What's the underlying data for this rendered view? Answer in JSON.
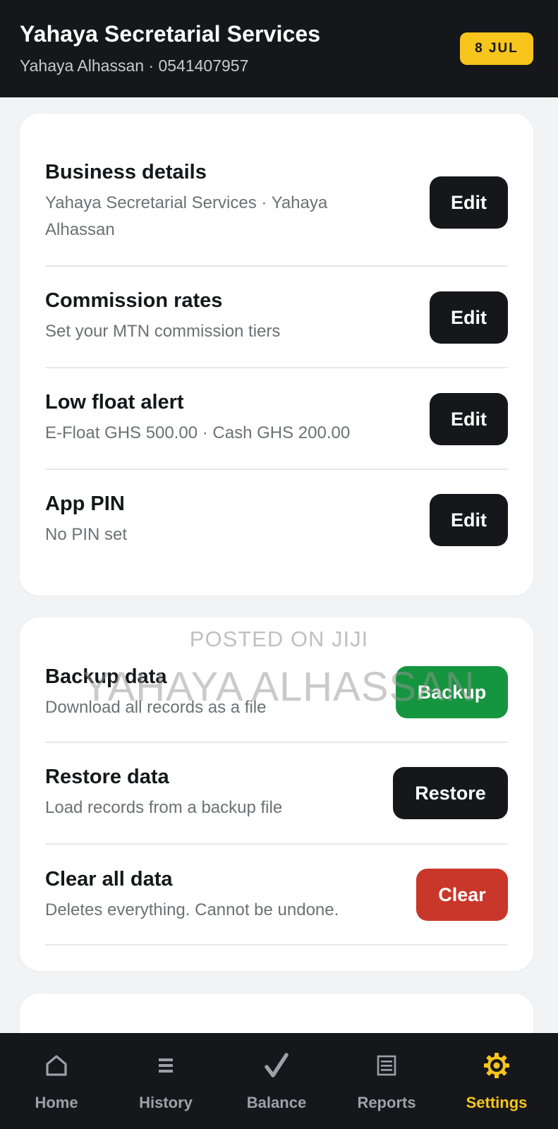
{
  "header": {
    "title": "Yahaya Secretarial Services",
    "subtitle": "Yahaya Alhassan · 0541407957",
    "date_badge": "8 JUL"
  },
  "settings_card": {
    "rows": [
      {
        "title": "Business details",
        "description": "Yahaya Secretarial Services · Yahaya Alhassan",
        "button": "Edit"
      },
      {
        "title": "Commission rates",
        "description": "Set your MTN commission tiers",
        "button": "Edit"
      },
      {
        "title": "Low float alert",
        "description": "E-Float GHS 500.00 · Cash GHS 200.00",
        "button": "Edit"
      },
      {
        "title": "App PIN",
        "description": "No PIN set",
        "button": "Edit"
      }
    ]
  },
  "data_card": {
    "rows": [
      {
        "title": "Backup data",
        "description": "Download all records as a file",
        "button": "Backup"
      },
      {
        "title": "Restore data",
        "description": "Load records from a backup file",
        "button": "Restore"
      },
      {
        "title": "Clear all data",
        "description": "Deletes everything. Cannot be undone.",
        "button": "Clear"
      }
    ]
  },
  "watermark": {
    "line1": "POSTED ON JIJI",
    "line2": "YAHAYA ALHASSAN"
  },
  "bottom_nav": {
    "items": [
      {
        "label": "Home",
        "icon": "home-icon"
      },
      {
        "label": "History",
        "icon": "list-icon"
      },
      {
        "label": "Balance",
        "icon": "checkmark-icon"
      },
      {
        "label": "Reports",
        "icon": "report-icon"
      },
      {
        "label": "Settings",
        "icon": "gear-icon",
        "active": true
      }
    ]
  },
  "colors": {
    "header_bg": "#16171a",
    "accent_yellow": "#f7c51c",
    "backup_green": "#15953f",
    "clear_red": "#c9362a",
    "button_dark": "#16171a"
  }
}
